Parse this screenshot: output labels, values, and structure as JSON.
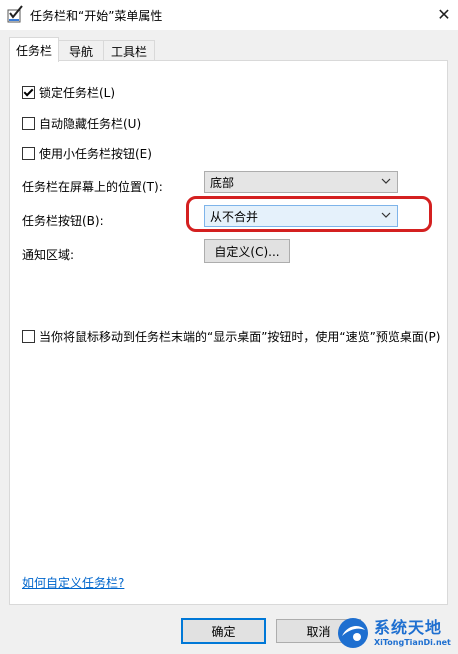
{
  "window": {
    "title": "任务栏和“开始”菜单属性",
    "close_glyph": "✕"
  },
  "tabs": [
    {
      "label": "任务栏",
      "active": true
    },
    {
      "label": "导航",
      "active": false
    },
    {
      "label": "工具栏",
      "active": false
    }
  ],
  "taskbar": {
    "lock": {
      "label": "锁定任务栏(L)",
      "checked": true
    },
    "autohide": {
      "label": "自动隐藏任务栏(U)",
      "checked": false
    },
    "small_buttons": {
      "label": "使用小任务栏按钮(E)",
      "checked": false
    },
    "location": {
      "label": "任务栏在屏幕上的位置(T):",
      "value": "底部"
    },
    "buttons": {
      "label": "任务栏按钮(B):",
      "value": "从不合并"
    },
    "notification": {
      "label": "通知区域:",
      "button_label": "自定义(C)..."
    },
    "peek": {
      "label": "当你将鼠标移动到任务栏末端的“显示桌面”按钮时，使用“速览”预览桌面(P)",
      "checked": false
    },
    "help_link": "如何自定义任务栏?"
  },
  "footer": {
    "ok_label": "确定",
    "cancel_label": "取消"
  },
  "watermark": {
    "main": "系统天地",
    "sub": "XiTongTianDi.net"
  },
  "colors": {
    "accent": "#0078d7",
    "highlight_circle": "#d42020",
    "link": "#0066cc"
  }
}
